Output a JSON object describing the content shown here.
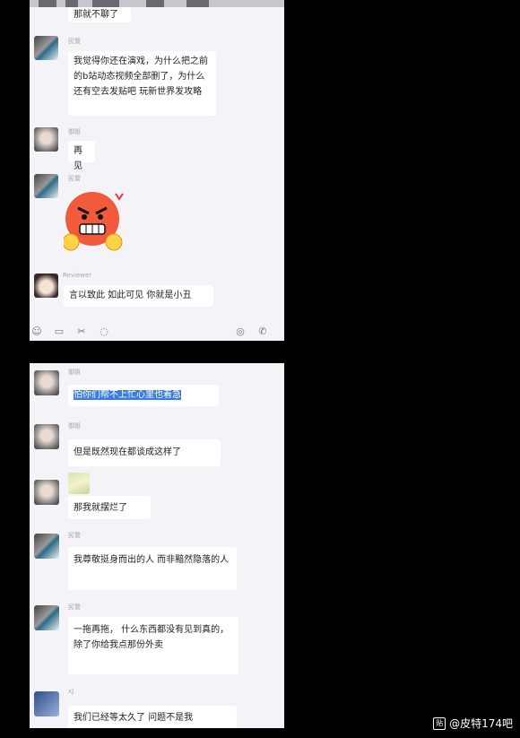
{
  "top_chat": {
    "messages": [
      {
        "name": "",
        "text": "那就不聊了"
      },
      {
        "name": "民警",
        "text": "我觉得你还在演戏，为什么把之前的b站动态视频全部删了，为什么还有空去发贴吧 玩新世界发攻略"
      },
      {
        "name": "御姐",
        "text": "再见"
      },
      {
        "name": "民警",
        "text": ""
      },
      {
        "name": "Reviewer",
        "text": "言以致此 如此可见 你就是小丑"
      }
    ]
  },
  "bottom_chat": {
    "messages": [
      {
        "name": "御姐",
        "text": "怕你们帮不上忙心里也着急"
      },
      {
        "name": "御姐",
        "text": "但是既然现在都谈成这样了"
      },
      {
        "name": "",
        "text": "那我就摆烂了"
      },
      {
        "name": "民警",
        "text": "我尊敬挺身而出的人 而非黯然隐落的人"
      },
      {
        "name": "民警",
        "text": "一拖再拖， 什么东西都没有见到真的， 除了你给我点那份外卖"
      },
      {
        "name": "xJ",
        "text": "我们已经等太久了 问题不是我"
      }
    ]
  },
  "toolbar": {
    "icons": [
      "emoji-icon",
      "folder-icon",
      "scissors-icon",
      "chat-icon",
      "video-icon",
      "phone-icon"
    ]
  },
  "watermark": {
    "text": "@皮特174吧",
    "icon_text": "贴"
  },
  "colors": {
    "panel_bg": "#f4f3f8",
    "highlight": "#3a7de0",
    "outer_bg": "#000000"
  }
}
